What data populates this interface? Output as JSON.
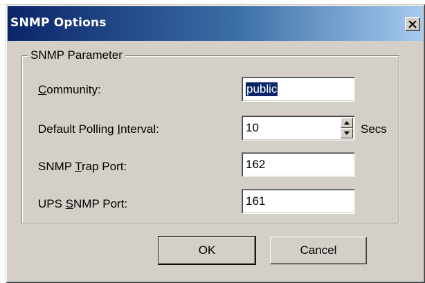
{
  "dialog": {
    "title": "SNMP Options",
    "close_glyph": "×"
  },
  "group": {
    "legend": "SNMP Parameter"
  },
  "fields": {
    "community": {
      "label_acc": "C",
      "label_rest": "ommunity:",
      "value": "public"
    },
    "polling": {
      "label_pre": "Default Polling ",
      "label_acc": "I",
      "label_rest": "nterval:",
      "value": "10",
      "unit": "Secs"
    },
    "trap_port": {
      "label_pre": "SNMP ",
      "label_acc": "T",
      "label_rest": "rap Port:",
      "value": "162"
    },
    "ups_port": {
      "label_pre": "UPS ",
      "label_acc": "S",
      "label_rest": "NMP Port:",
      "value": "161"
    }
  },
  "buttons": {
    "ok": "OK",
    "cancel": "Cancel"
  },
  "icons": {
    "close": "close-icon",
    "spin_up": "spin-up-arrow-icon",
    "spin_down": "spin-down-arrow-icon"
  },
  "colors": {
    "titlebar_start": "#0a246a",
    "titlebar_end": "#a6caf0",
    "face": "#d4d0c8",
    "selection": "#0a246a"
  }
}
